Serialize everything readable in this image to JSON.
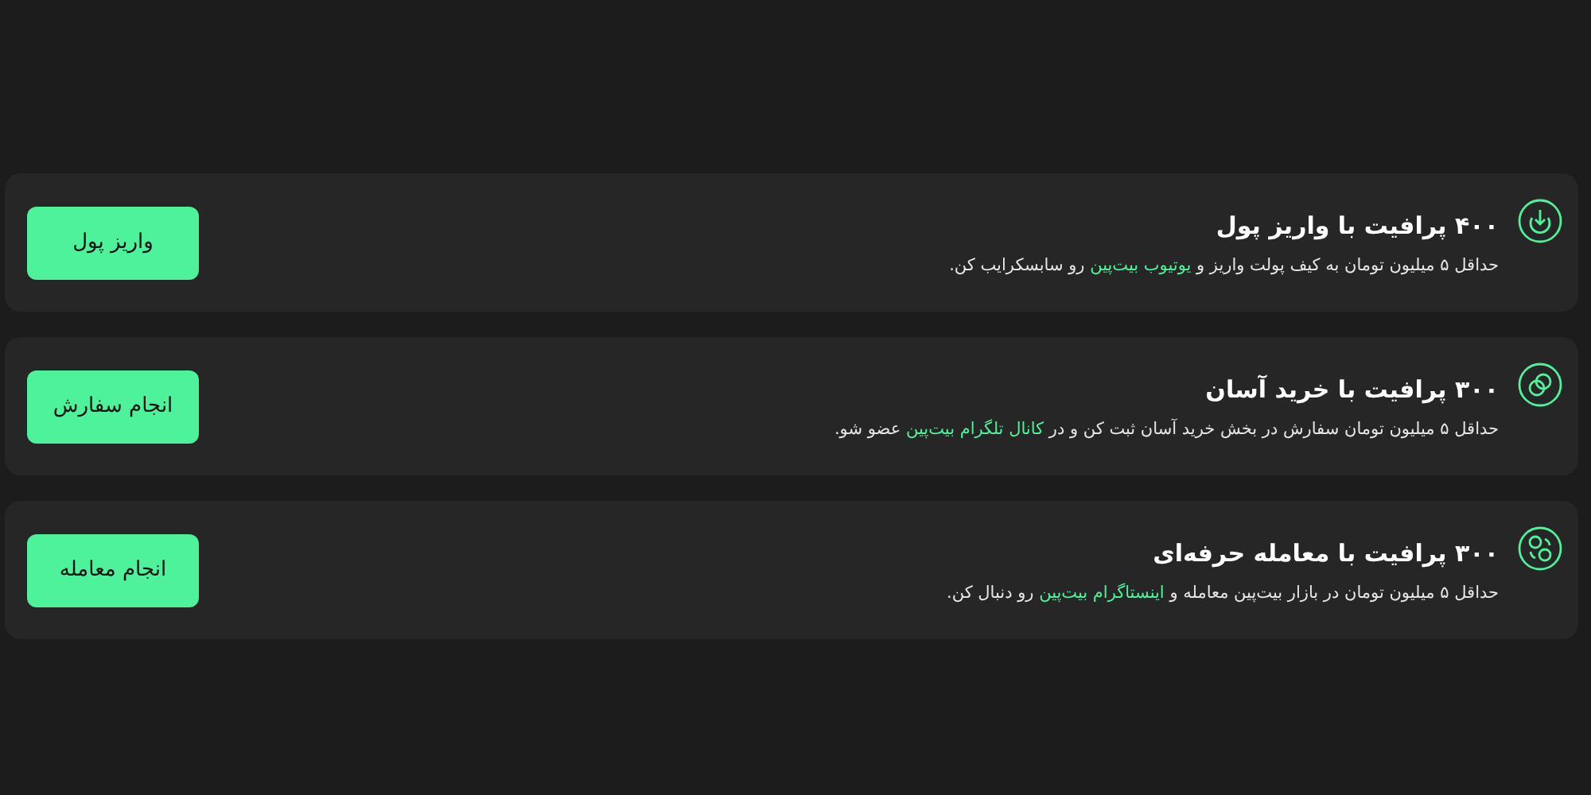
{
  "offers": [
    {
      "kind": "deposit",
      "title": "۴۰۰ پرافیت با واریز پول",
      "description": [
        {
          "text": "حداقل ۵ میلیون تومان به کیف پولت واریز و ",
          "link": false
        },
        {
          "text": "یوتیوب بیت‌پین",
          "link": true
        },
        {
          "text": " رو سابسکرایب کن.",
          "link": false
        }
      ],
      "button": "واریز پول"
    },
    {
      "kind": "coins",
      "title": "۳۰۰ پرافیت با خرید آسان",
      "description": [
        {
          "text": "حداقل ۵ میلیون تومان سفارش در بخش خرید آسان ثبت کن و در ",
          "link": false
        },
        {
          "text": "کانال تلگرام بیت‌پین",
          "link": true
        },
        {
          "text": " عضو شو.",
          "link": false
        }
      ],
      "button": "انجام سفارش"
    },
    {
      "kind": "trade",
      "title": "۳۰۰ پرافیت با معامله حرفه‌ای",
      "description": [
        {
          "text": "حداقل ۵ میلیون تومان در بازار بیت‌پین معامله و ",
          "link": false
        },
        {
          "text": "اینستاگرام بیت‌پین",
          "link": true
        },
        {
          "text": " رو دنبال کن.",
          "link": false
        }
      ],
      "button": "انجام معامله"
    }
  ]
}
